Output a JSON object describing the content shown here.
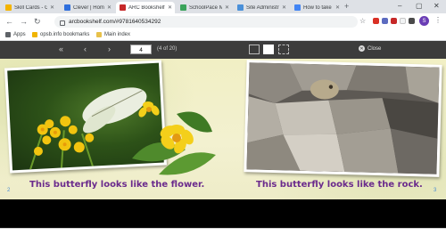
{
  "browser": {
    "tabs": [
      {
        "title": "Skill Cards - Gr",
        "favicon_color": "#f4b400",
        "active": false
      },
      {
        "title": "Clever | Homep",
        "favicon_color": "#2f6fdd",
        "active": false
      },
      {
        "title": "ARC Bookshelf",
        "favicon_color": "#c62828",
        "active": true
      },
      {
        "title": "SchoolPace M",
        "favicon_color": "#3aa35a",
        "active": false
      },
      {
        "title": "Site Administr",
        "favicon_color": "#4a90d9",
        "active": false
      },
      {
        "title": "How to take a",
        "favicon_color": "#4285f4",
        "active": false
      }
    ],
    "new_tab_glyph": "+",
    "window_controls": [
      "–",
      "▢",
      "✕"
    ],
    "url": "arcbookshelf.com/#9781640534292",
    "bookmarks": [
      {
        "label": "Apps",
        "icon_color": "#5f6368"
      },
      {
        "label": "opsb.info bookmarks",
        "icon_color": "#f0b400"
      },
      {
        "label": "Main index",
        "icon_color": "#e8c14a"
      }
    ],
    "profile_initial": "S"
  },
  "reader": {
    "page_input": "4",
    "page_of": "(4 of 20)",
    "close_label": "Close",
    "left_caption": "This butterfly looks like the flower.",
    "right_caption": "This butterfly looks like the rock.",
    "left_page_number": "2",
    "right_page_number": "3"
  },
  "colors": {
    "caption": "#6a2a8c",
    "toolbar": "#3c3c3c",
    "page_bg": "#f1efc4"
  }
}
